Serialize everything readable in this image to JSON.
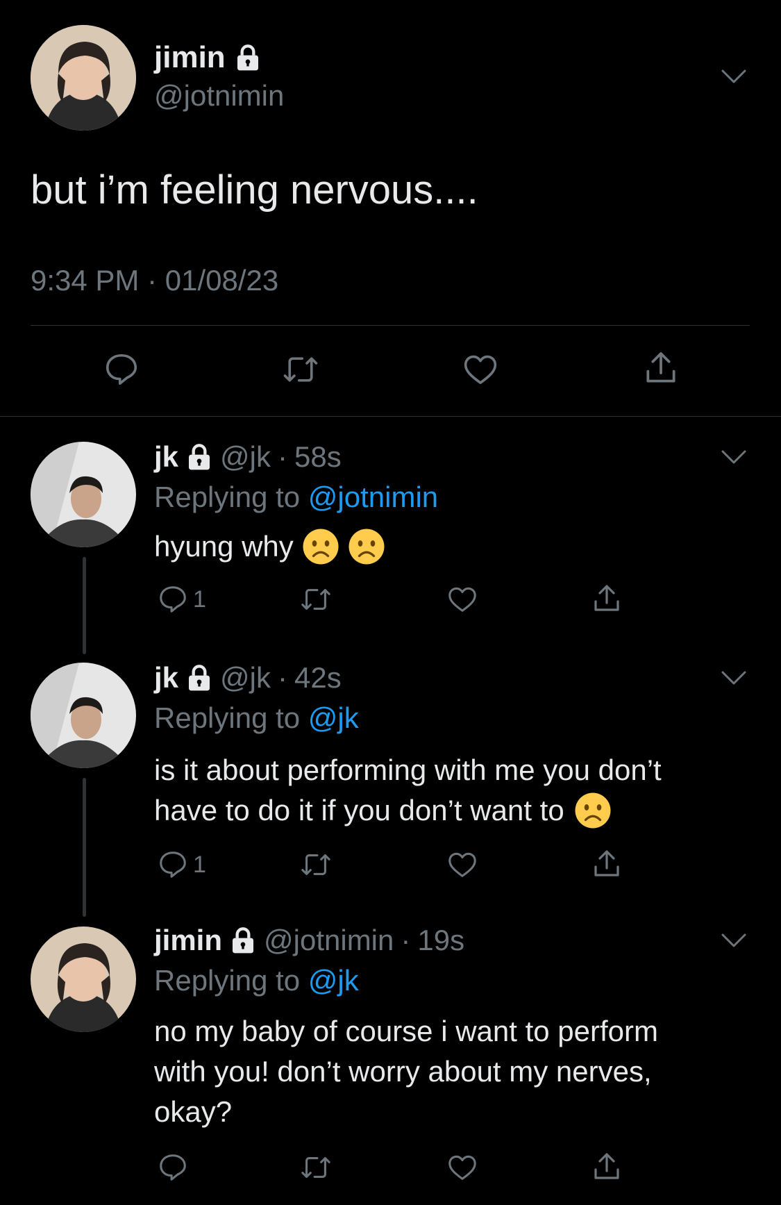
{
  "main_tweet": {
    "name": "jimin",
    "handle": "@jotnimin",
    "text": "but i’m feeling nervous....",
    "time": "9:34 PM",
    "date": "01/08/23",
    "sep": "·"
  },
  "replies": [
    {
      "name": "jk",
      "handle": "@jk",
      "time": "58s",
      "replying_label": "Replying to",
      "replying_to": "@jotnimin",
      "text": "hyung why",
      "reply_count": "1"
    },
    {
      "name": "jk",
      "handle": "@jk",
      "time": "42s",
      "replying_label": "Replying to",
      "replying_to": "@jk",
      "text_line1": "is it about performing with me you don’t",
      "text_line2": "have to do it if you don’t want to",
      "reply_count": "1"
    },
    {
      "name": "jimin",
      "handle": "@jotnimin",
      "time": "19s",
      "replying_label": "Replying to",
      "replying_to": "@jk",
      "text_line1": "no my baby of course i want to perform",
      "text_line2": "with you! don’t worry about my nerves,",
      "text_line3": "okay?"
    }
  ],
  "dot": "·",
  "colors": {
    "background": "#000000",
    "text": "#e7e9ea",
    "muted": "#6e767d",
    "link": "#1d9bf0",
    "divider": "#2f3336"
  },
  "icons": [
    "lock-icon",
    "chevron-down-icon",
    "reply-icon",
    "retweet-icon",
    "like-icon",
    "share-icon",
    "frowning-face-emoji"
  ]
}
